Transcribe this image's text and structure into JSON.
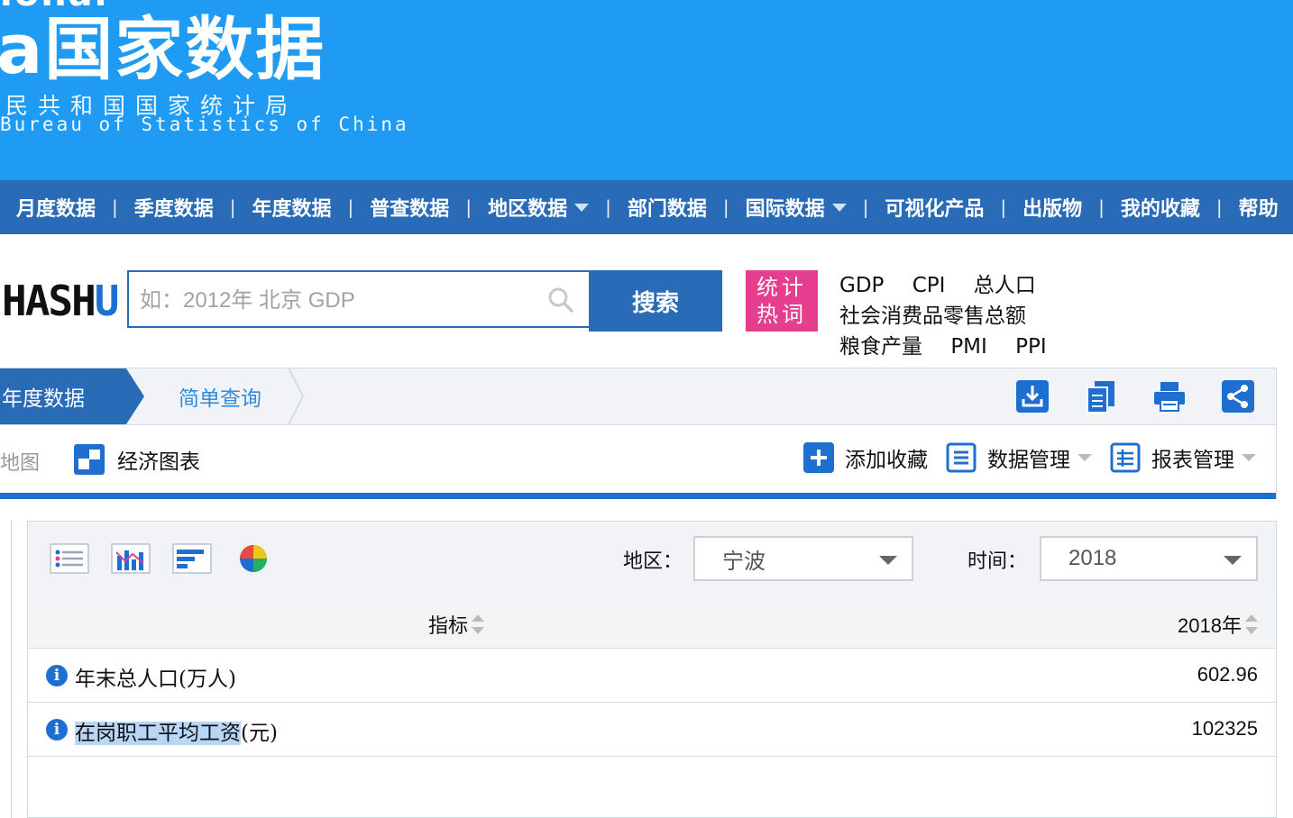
{
  "header": {
    "logo_top": "ional",
    "logo_cn": "a国家数据",
    "logo_sub": "民共和国国家统计局",
    "logo_en": "Bureau of Statistics of China"
  },
  "nav": {
    "items": [
      "月度数据",
      "季度数据",
      "年度数据",
      "普查数据",
      "地区数据",
      "部门数据",
      "国际数据",
      "可视化产品",
      "出版物",
      "我的收藏",
      "帮助"
    ]
  },
  "search": {
    "brand_left": "HASH",
    "brand_right": "U",
    "placeholder": "如：2012年 北京 GDP",
    "button": "搜索"
  },
  "hot": {
    "badge_line1": "统计",
    "badge_line2": "热词",
    "links": [
      "GDP",
      "CPI",
      "总人口",
      "社会消费品零售总额",
      "粮食产量",
      "PMI",
      "PPI"
    ]
  },
  "breadcrumb": {
    "active": "年度数据",
    "second": "简单查询"
  },
  "subbar": {
    "map": "地图",
    "chart": "经济图表",
    "add_fav": "添加收藏",
    "data_mgmt": "数据管理",
    "report_mgmt": "报表管理"
  },
  "filters": {
    "region_label": "地区：",
    "region_value": "宁波",
    "time_label": "时间：",
    "time_value": "2018"
  },
  "table": {
    "col_indicator": "指标",
    "col_year": "2018年",
    "rows": [
      {
        "name": "年末总人口(万人)",
        "value": "602.96"
      },
      {
        "name_hl": "在岗职工平均工资",
        "name_rest": "(元)",
        "value": "102325"
      }
    ]
  },
  "colors": {
    "header_blue": "#1f9bf3",
    "nav_blue": "#2a6bb8",
    "accent_blue": "#1f6fd1",
    "hot_pink": "#e53e8e"
  }
}
